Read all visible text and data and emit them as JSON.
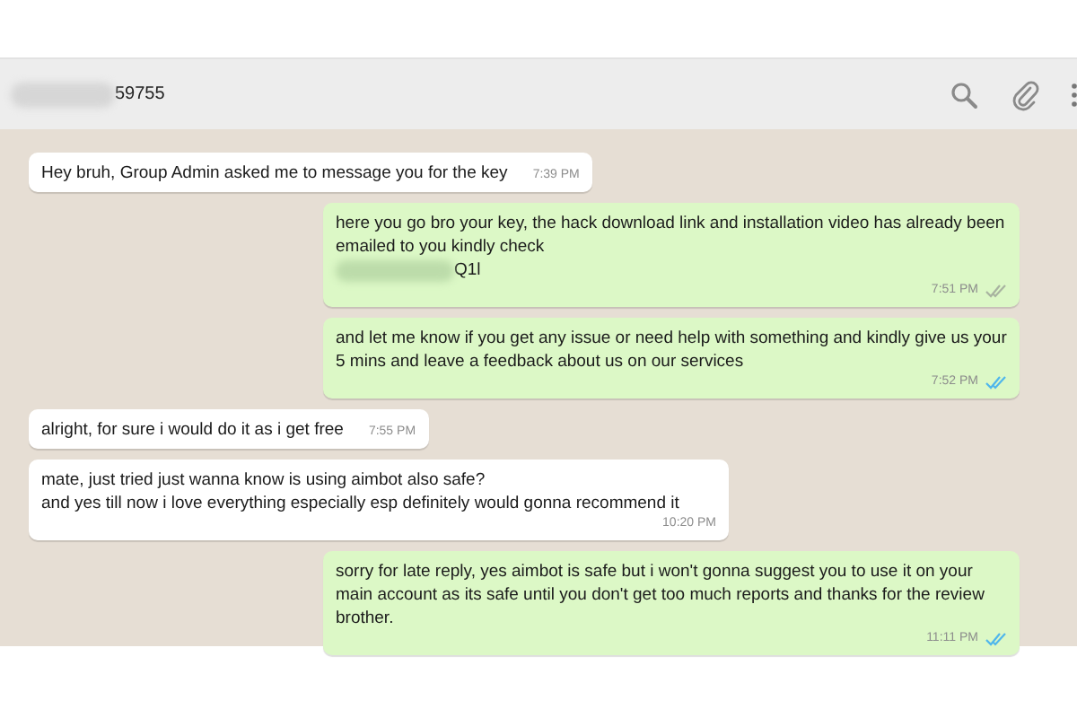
{
  "header": {
    "title": "59755"
  },
  "messages": [
    {
      "kind": "incoming",
      "text": "Hey bruh, Group Admin asked me to message you for the key",
      "time": "7:39 PM"
    },
    {
      "kind": "outgoing",
      "text": "here you go bro your key, the hack download link and installation video has already been emailed to you kindly check",
      "redacted_tail": "Q1l",
      "time": "7:51 PM",
      "read": false
    },
    {
      "kind": "outgoing",
      "text": "and let me know if you get any issue or need help with something and kindly give us your 5 mins and leave a feedback about us on our services",
      "time": "7:52 PM",
      "read": true
    },
    {
      "kind": "incoming",
      "text": "alright, for sure i would do it as i get free",
      "time": "7:55 PM"
    },
    {
      "kind": "incoming",
      "text": "mate, just tried just wanna know is using aimbot also safe?\nand yes till now i love everything especially esp definitely would gonna recommend it",
      "time": "10:20 PM"
    },
    {
      "kind": "outgoing",
      "text": "sorry for late reply, yes aimbot is safe but i won't gonna suggest you to use it on your main account as its safe until you don't get too much reports and thanks for the review brother.",
      "time": "11:11 PM",
      "read": true
    }
  ]
}
